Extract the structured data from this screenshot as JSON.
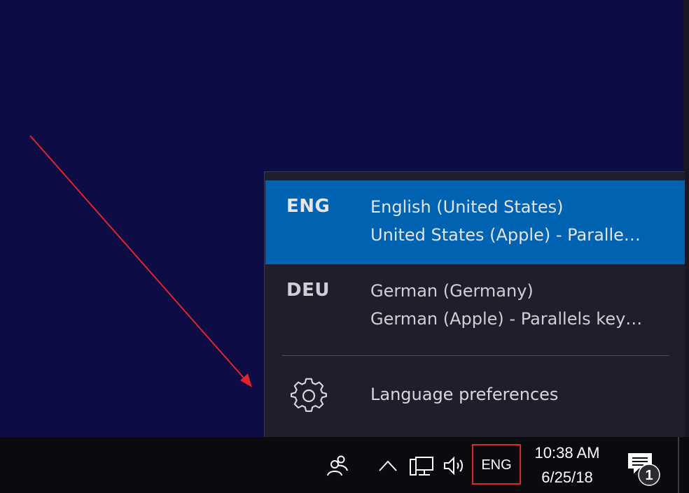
{
  "flyout": {
    "languages": [
      {
        "code": "ENG",
        "name": "English (United States)",
        "keyboard": "United States (Apple) - Paralle…",
        "selected": true
      },
      {
        "code": "DEU",
        "name": "German (Germany)",
        "keyboard": "German (Apple) - Parallels key…",
        "selected": false
      }
    ],
    "preferences_label": "Language preferences",
    "preferences_icon": "gear-icon",
    "selected_color": "#0063b1"
  },
  "taskbar": {
    "input_indicator": "ENG",
    "time": "10:38 AM",
    "date": "6/25/18",
    "notification_count": "1",
    "icons": [
      "people-icon",
      "chevron-up-icon",
      "network-icon",
      "volume-icon",
      "action-center-icon"
    ]
  },
  "annotation": {
    "arrow_color": "#e0232d",
    "box_color": "#e0232d"
  }
}
